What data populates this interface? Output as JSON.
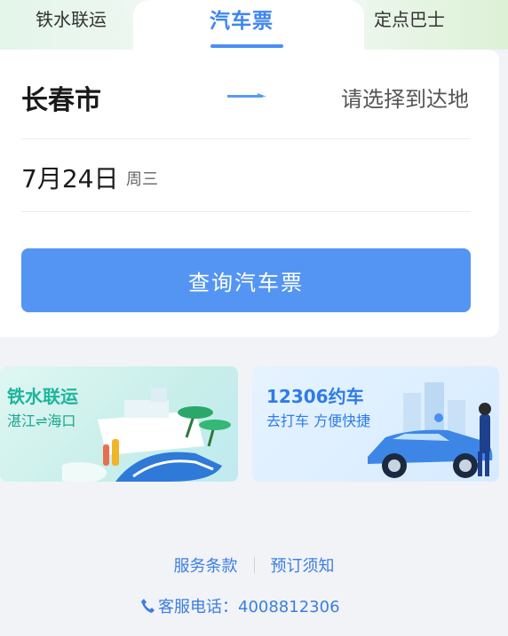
{
  "tabs": [
    {
      "label": "铁水联运"
    },
    {
      "label": "汽车票",
      "active": true
    },
    {
      "label": "定点巴士"
    }
  ],
  "search": {
    "from_city": "长春市",
    "to_placeholder": "请选择到达地",
    "date": "7月24日",
    "weekday": "周三",
    "button_label": "查询汽车票"
  },
  "banners": {
    "left": {
      "title": "铁水联运",
      "subtitle": "湛江⇌海口"
    },
    "right": {
      "title": "12306约车",
      "subtitle": "去打车 方便快捷"
    }
  },
  "footer": {
    "terms": "服务条款",
    "notice": "预订须知",
    "hotline": "客服电话：4008812306"
  },
  "colors": {
    "accent": "#3f86f0",
    "button": "#5495f4",
    "green_text": "#1fb59c"
  }
}
